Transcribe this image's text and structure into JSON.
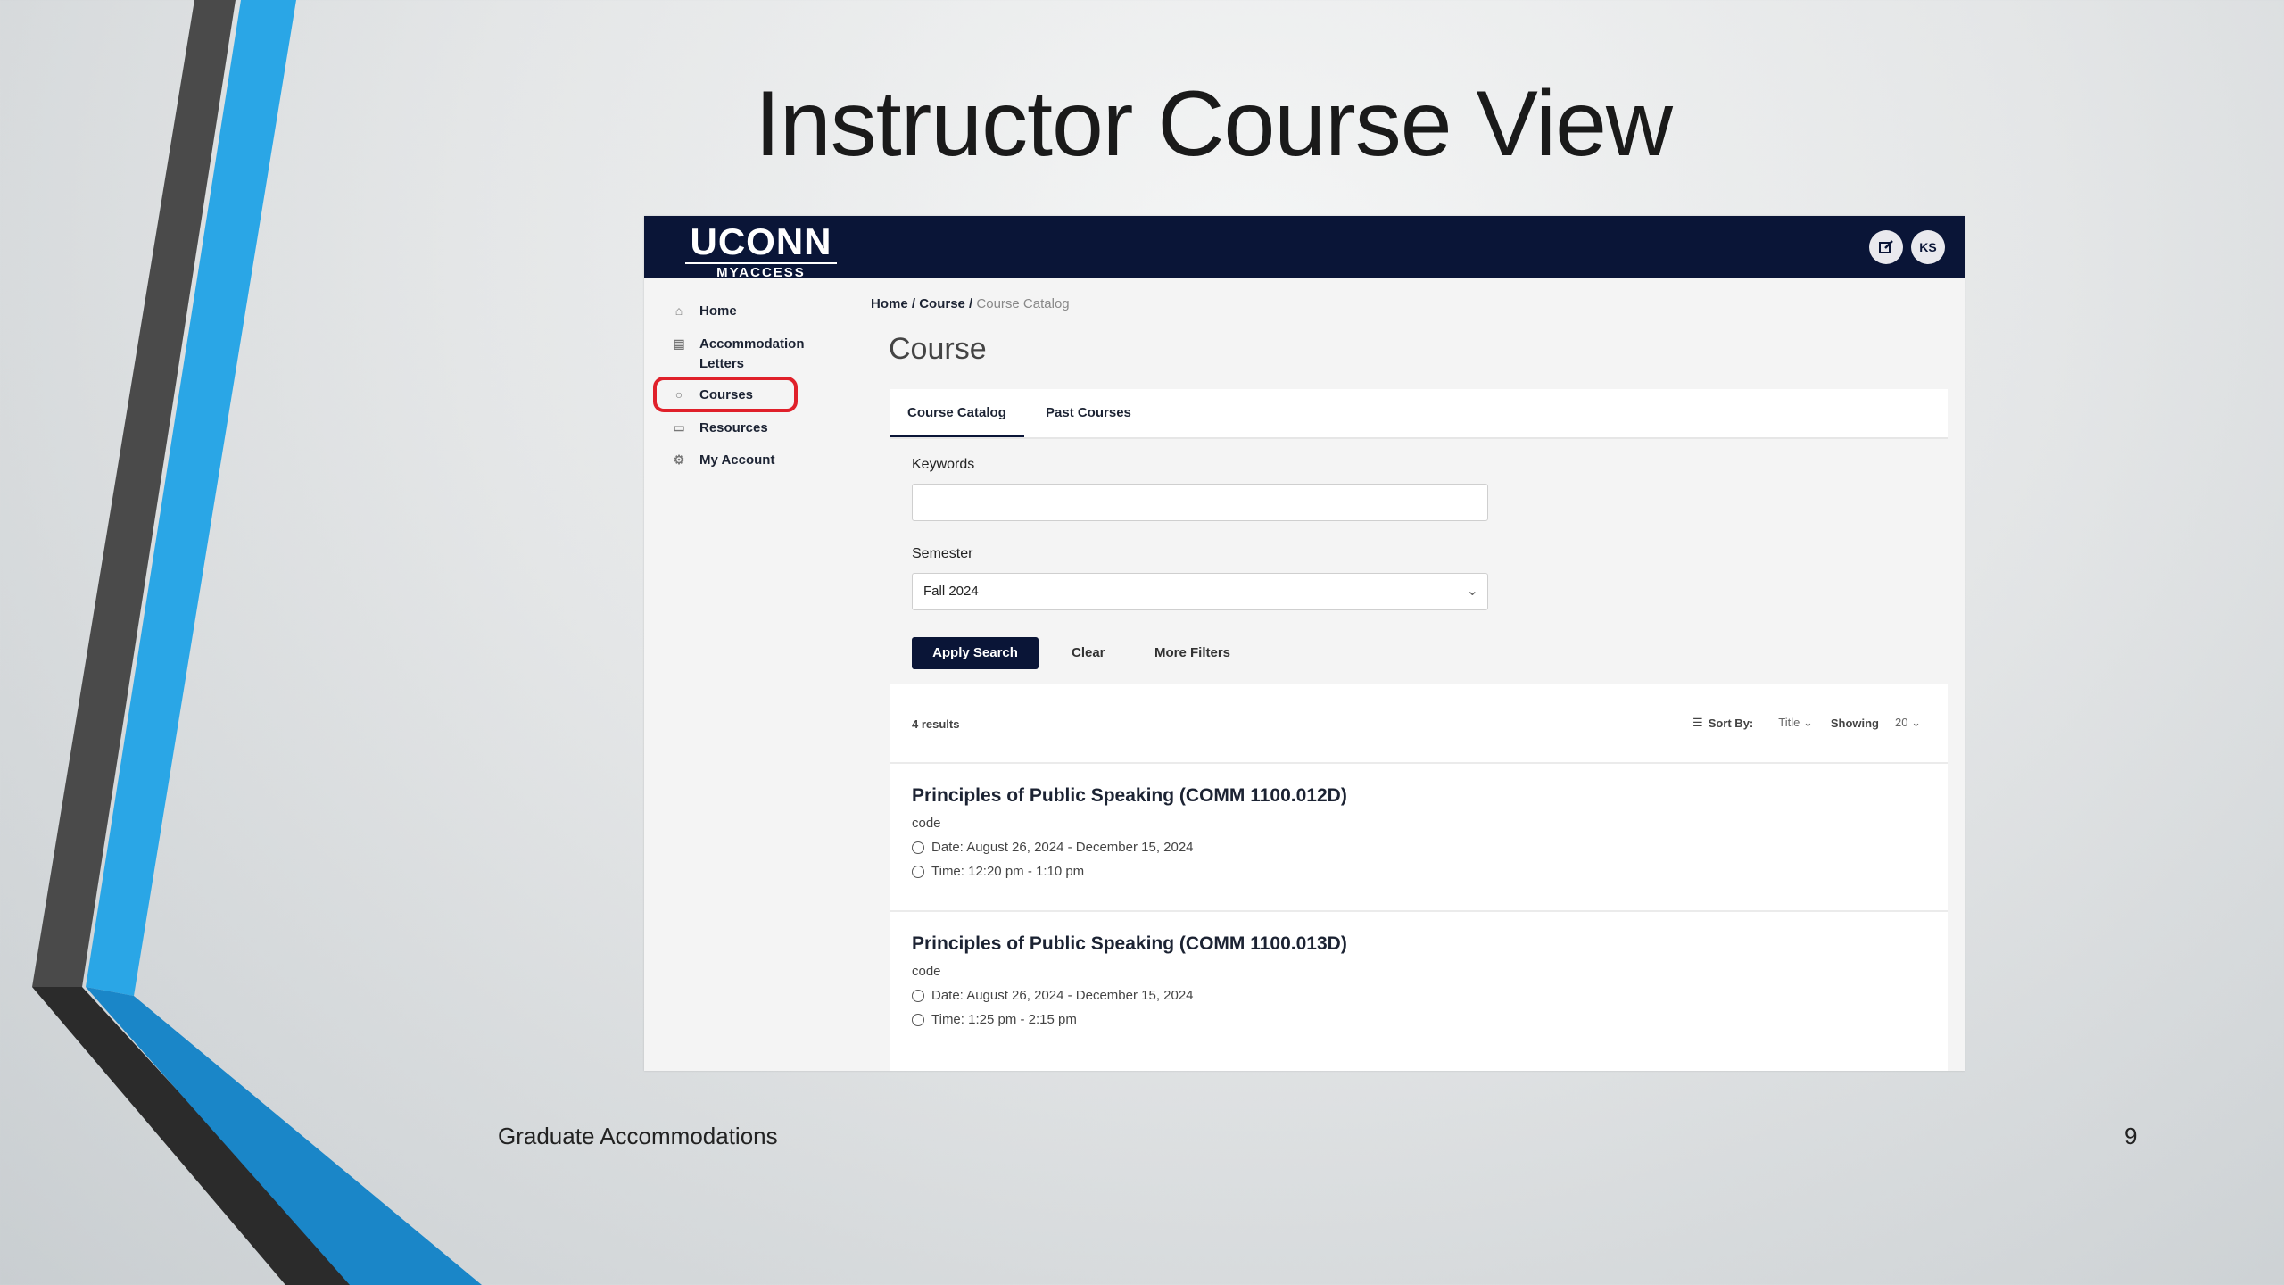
{
  "slide": {
    "title": "Instructor Course View",
    "footer_left": "Graduate Accommodations",
    "page_number": "9"
  },
  "app": {
    "logo_main": "UCONN",
    "logo_sub": "MYACCESS",
    "user_initials": "KS",
    "nav": [
      {
        "label": "Home",
        "icon": "home-icon"
      },
      {
        "label": "Accommodation Letters",
        "icon": "letter-icon"
      },
      {
        "label": "Courses",
        "icon": "courses-icon"
      },
      {
        "label": "Resources",
        "icon": "resources-icon"
      },
      {
        "label": "My Account",
        "icon": "gear-icon"
      }
    ],
    "breadcrumb": {
      "home": "Home",
      "sep1": " / ",
      "course": "Course",
      "sep2": " / ",
      "current": "Course Catalog"
    },
    "page_title": "Course",
    "tabs": [
      {
        "label": "Course Catalog",
        "active": true
      },
      {
        "label": "Past Courses",
        "active": false
      }
    ],
    "filters": {
      "keywords_label": "Keywords",
      "keywords_value": "",
      "semester_label": "Semester",
      "semester_value": "Fall 2024",
      "apply_label": "Apply Search",
      "clear_label": "Clear",
      "more_label": "More Filters"
    },
    "results": {
      "count_text": "4 results",
      "sort_label": "Sort By:",
      "sort_value": "Title",
      "showing_label": "Showing",
      "showing_value": "20",
      "courses": [
        {
          "title": "Principles of Public Speaking (COMM 1100.012D)",
          "code": "code",
          "date": "Date: August 26, 2024 - December 15, 2024",
          "time": "Time: 12:20 pm - 1:10 pm"
        },
        {
          "title": "Principles of Public Speaking (COMM 1100.013D)",
          "code": "code",
          "date": "Date: August 26, 2024 - December 15, 2024",
          "time": "Time: 1:25 pm - 2:15 pm"
        }
      ]
    }
  },
  "colors": {
    "navy": "#0a1537",
    "accent_blue": "#2aa6e6",
    "highlight_red": "#e0202a"
  }
}
